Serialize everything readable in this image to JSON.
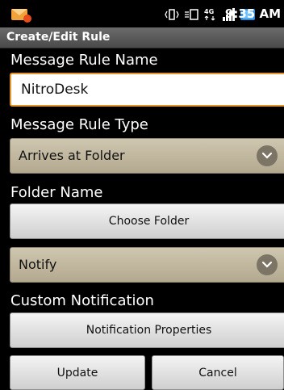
{
  "status_bar": {
    "time": "9:35 AM",
    "icons": [
      "sms-notification-icon",
      "vibrate-icon",
      "data-sync-icon",
      "4g-icon",
      "signal-icon",
      "battery-icon"
    ]
  },
  "title_bar": {
    "title": "Create/Edit Rule"
  },
  "form": {
    "rule_name_label": "Message Rule Name",
    "rule_name_value": "NitroDesk",
    "rule_type_label": "Message Rule Type",
    "rule_type_value": "Arrives at Folder",
    "folder_name_label": "Folder Name",
    "choose_folder_button": "Choose Folder",
    "action_value": "Notify",
    "custom_notification_label": "Custom Notification",
    "notification_properties_button": "Notification Properties",
    "update_button": "Update",
    "cancel_button": "Cancel"
  },
  "colors": {
    "background": "#000000",
    "input_focus_border": "#e8962c",
    "spinner_bg": "#bfb69e",
    "button_bg": "#e2e2e2"
  }
}
